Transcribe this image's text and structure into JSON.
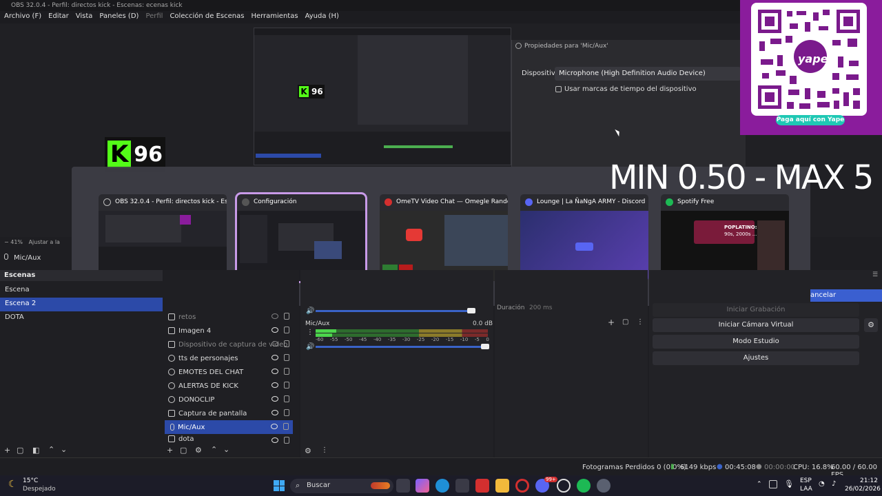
{
  "window": {
    "title": "OBS 32.0.4 - Perfil: directos kick - Escenas: ecenas kick"
  },
  "menu": [
    "Archivo (F)",
    "Editar",
    "Vista",
    "Paneles (D)",
    "Perfil",
    "Colección de Escenas",
    "Herramientas",
    "Ayuda (H)"
  ],
  "preview": {
    "kick_badge": "96",
    "zoom": "41%",
    "zoom_label": "Ajustar a la",
    "source_label": "Mic/Aux"
  },
  "properties": {
    "title": "Propiedades para 'Mic/Aux'",
    "device_label": "Dispositivo",
    "device_value": "Microphone (High Definition Audio Device)",
    "timestamps_label": "Usar marcas de tiempo del dispositivo"
  },
  "overlay": {
    "minmax": "MIN 0.50 - MAX 5",
    "yape_brand": "yape",
    "yape_cta": "Paga aquí con Yape"
  },
  "alttab": [
    {
      "title": "OBS 32.0.4 - Perfil: directos kick - Escenas...",
      "icon_color": "#3a3a3a"
    },
    {
      "title": "Configuración",
      "icon_color": "#555555"
    },
    {
      "title": "OmeTV Video Chat — Omegle Random C...",
      "icon_color": "#d32f2f"
    },
    {
      "title": "Lounge | La ÑaNgA ARMY - Discord",
      "icon_color": "#5865f2"
    },
    {
      "title": "Spotify Free",
      "icon_color": "#1db954"
    }
  ],
  "spotify_thumb": {
    "headline": "POPLATINO:",
    "sub": "90s, 2000s ..."
  },
  "scenes": {
    "header": "Escenas",
    "items": [
      "Escena",
      "Escena 2",
      "DOTA"
    ]
  },
  "sources": [
    {
      "name": "retos",
      "dim": true
    },
    {
      "name": "Imagen 4"
    },
    {
      "name": "Dispositivo de captura de video",
      "dim": true
    },
    {
      "name": "tts de personajes"
    },
    {
      "name": "EMOTES DEL CHAT"
    },
    {
      "name": "ALERTAS DE KICK"
    },
    {
      "name": "DONOCLIP"
    },
    {
      "name": "Captura de pantalla"
    },
    {
      "name": "Mic/Aux"
    },
    {
      "name": "dota"
    }
  ],
  "mixer": {
    "channel": "Mic/Aux",
    "db": "0.0 dB",
    "ticks": [
      "-60",
      "-55",
      "-50",
      "-45",
      "-40",
      "-35",
      "-30",
      "-25",
      "-20",
      "-15",
      "-10",
      "-5",
      "0"
    ]
  },
  "transitions": {
    "duration_label": "Duración",
    "duration_value": "200 ms"
  },
  "controls": {
    "cancel": "ancelar",
    "recording": "Iniciar Grabación",
    "virtual_cam": "Iniciar Cámara Virtual",
    "studio_mode": "Modo Estudio",
    "settings": "Ajustes"
  },
  "status": {
    "dropped": "Fotogramas Perdidos 0 (0.0%)",
    "bitrate": "6149 kbps",
    "live_time": "00:45:08",
    "rec_time": "00:00:00",
    "cpu": "CPU: 16.8%",
    "fps": "60.00 / 60.00 FPS"
  },
  "taskbar": {
    "weather_temp": "15°C",
    "weather_desc": "Despejado",
    "search": "Buscar",
    "lang": "ESP",
    "region": "LAA",
    "time": "21:12",
    "date": "26/02/2026",
    "badge": "99+"
  },
  "colors": {
    "accent": "#2c4aa8",
    "kick": "#53fc18",
    "yape": "#8a1c9c",
    "selection_outline": "#c89ae8"
  }
}
